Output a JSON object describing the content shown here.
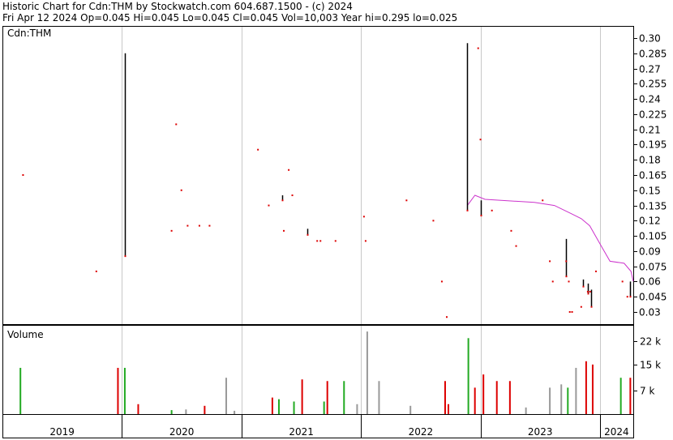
{
  "header": {
    "line1": "Historic Chart for Cdn:THM by Stockwatch.com 604.687.1500 - (c) 2024",
    "line2": "Fri Apr 12 2024   Op=0.045  Hi=0.045  Lo=0.045  Cl=0.045  Vol=10,003  Year hi=0.295  lo=0.025"
  },
  "colors": {
    "up": "#22aa22",
    "down": "#dd0000",
    "neutral": "#999999",
    "ma": "#cc33cc",
    "bar": "#000000",
    "grid": "#c8c8c8"
  },
  "chart_data": [
    {
      "type": "line",
      "title": "Cdn:THM",
      "symbol": "Cdn:THM",
      "y_ticks": [
        "0.30",
        "0.285",
        "0.27",
        "0.255",
        "0.24",
        "0.225",
        "0.21",
        "0.195",
        "0.18",
        "0.165",
        "0.15",
        "0.135",
        "0.12",
        "0.105",
        "0.09",
        "0.075",
        "0.06",
        "0.045",
        "0.03"
      ],
      "ylim": [
        0.018,
        0.312
      ],
      "x_ticks": [
        "2019",
        "2020",
        "2021",
        "2022",
        "2023",
        "2024"
      ],
      "xlim": [
        "2019-01-01",
        "2024-04-12"
      ],
      "ranges": [
        {
          "date": "2020-01-10",
          "high": 0.285,
          "low": 0.085
        },
        {
          "date": "2021-05-05",
          "high": 0.145,
          "low": 0.14
        },
        {
          "date": "2021-07-20",
          "high": 0.112,
          "low": 0.106
        },
        {
          "date": "2022-11-20",
          "high": 0.295,
          "low": 0.13
        },
        {
          "date": "2023-01-01",
          "high": 0.14,
          "low": 0.125
        },
        {
          "date": "2023-09-20",
          "high": 0.102,
          "low": 0.065
        },
        {
          "date": "2023-11-10",
          "high": 0.062,
          "low": 0.055
        },
        {
          "date": "2023-11-25",
          "high": 0.058,
          "low": 0.048
        },
        {
          "date": "2023-12-05",
          "high": 0.052,
          "low": 0.035
        },
        {
          "date": "2024-04-03",
          "high": 0.06,
          "low": 0.045
        }
      ],
      "points": [
        {
          "date": "2019-03-05",
          "price": 0.165
        },
        {
          "date": "2019-10-15",
          "price": 0.07
        },
        {
          "date": "2020-06-01",
          "price": 0.11
        },
        {
          "date": "2020-06-15",
          "price": 0.215
        },
        {
          "date": "2020-07-01",
          "price": 0.15
        },
        {
          "date": "2020-07-20",
          "price": 0.115
        },
        {
          "date": "2020-08-25",
          "price": 0.115
        },
        {
          "date": "2020-09-25",
          "price": 0.115
        },
        {
          "date": "2021-02-20",
          "price": 0.19
        },
        {
          "date": "2021-03-25",
          "price": 0.135
        },
        {
          "date": "2021-05-10",
          "price": 0.11
        },
        {
          "date": "2021-05-25",
          "price": 0.17
        },
        {
          "date": "2021-06-05",
          "price": 0.145
        },
        {
          "date": "2021-08-20",
          "price": 0.1
        },
        {
          "date": "2021-08-30",
          "price": 0.1
        },
        {
          "date": "2021-10-15",
          "price": 0.1
        },
        {
          "date": "2022-01-10",
          "price": 0.124
        },
        {
          "date": "2022-01-15",
          "price": 0.1
        },
        {
          "date": "2022-05-20",
          "price": 0.14
        },
        {
          "date": "2022-08-10",
          "price": 0.12
        },
        {
          "date": "2022-09-05",
          "price": 0.06
        },
        {
          "date": "2022-09-20",
          "price": 0.025
        },
        {
          "date": "2022-12-25",
          "price": 0.29
        },
        {
          "date": "2023-01-01",
          "price": 0.2
        },
        {
          "date": "2023-02-05",
          "price": 0.13
        },
        {
          "date": "2023-04-05",
          "price": 0.11
        },
        {
          "date": "2023-04-20",
          "price": 0.095
        },
        {
          "date": "2023-07-10",
          "price": 0.14
        },
        {
          "date": "2023-08-01",
          "price": 0.08
        },
        {
          "date": "2023-08-10",
          "price": 0.06
        },
        {
          "date": "2023-09-20",
          "price": 0.08
        },
        {
          "date": "2023-09-28",
          "price": 0.06
        },
        {
          "date": "2023-10-01",
          "price": 0.03
        },
        {
          "date": "2023-10-08",
          "price": 0.03
        },
        {
          "date": "2023-11-05",
          "price": 0.035
        },
        {
          "date": "2023-11-25",
          "price": 0.05
        },
        {
          "date": "2023-12-02",
          "price": 0.05
        },
        {
          "date": "2023-12-20",
          "price": 0.07
        },
        {
          "date": "2024-03-10",
          "price": 0.06
        },
        {
          "date": "2024-03-25",
          "price": 0.045
        }
      ],
      "moving_average": {
        "color": "#cc33cc",
        "points": [
          {
            "date": "2022-11-22",
            "value": 0.135
          },
          {
            "date": "2022-12-15",
            "value": 0.145
          },
          {
            "date": "2023-01-15",
            "value": 0.141
          },
          {
            "date": "2023-06-15",
            "value": 0.138
          },
          {
            "date": "2023-08-15",
            "value": 0.135
          },
          {
            "date": "2023-10-05",
            "value": 0.127
          },
          {
            "date": "2023-11-05",
            "value": 0.122
          },
          {
            "date": "2023-12-01",
            "value": 0.115
          },
          {
            "date": "2024-01-05",
            "value": 0.095
          },
          {
            "date": "2024-02-01",
            "value": 0.08
          },
          {
            "date": "2024-03-15",
            "value": 0.078
          },
          {
            "date": "2024-04-05",
            "value": 0.07
          },
          {
            "date": "2024-04-12",
            "value": 0.06
          }
        ]
      }
    },
    {
      "type": "bar",
      "title": "Volume",
      "y_ticks": [
        "22 k",
        "15 k",
        "7 k"
      ],
      "ylim": [
        0,
        27000
      ],
      "x_ticks": [
        "2019",
        "2020",
        "2021",
        "2022",
        "2023",
        "2024"
      ],
      "bars": [
        {
          "date": "2019-02-25",
          "volume": 14000,
          "dir": "up"
        },
        {
          "date": "2019-12-20",
          "volume": 14000,
          "dir": "down"
        },
        {
          "date": "2020-02-20",
          "volume": 3000,
          "dir": "down"
        },
        {
          "date": "2020-01-10",
          "volume": 14000,
          "dir": "up"
        },
        {
          "date": "2020-06-01",
          "volume": 1200,
          "dir": "up"
        },
        {
          "date": "2020-07-15",
          "volume": 1400,
          "dir": "neutral"
        },
        {
          "date": "2020-09-10",
          "volume": 2500,
          "dir": "down"
        },
        {
          "date": "2020-11-15",
          "volume": 11000,
          "dir": "neutral"
        },
        {
          "date": "2020-12-10",
          "volume": 1000,
          "dir": "neutral"
        },
        {
          "date": "2021-04-25",
          "volume": 4500,
          "dir": "up"
        },
        {
          "date": "2021-04-05",
          "volume": 5000,
          "dir": "down"
        },
        {
          "date": "2021-06-10",
          "volume": 3800,
          "dir": "up"
        },
        {
          "date": "2021-07-05",
          "volume": 10500,
          "dir": "down"
        },
        {
          "date": "2021-09-20",
          "volume": 10000,
          "dir": "down"
        },
        {
          "date": "2021-09-10",
          "volume": 3800,
          "dir": "up"
        },
        {
          "date": "2021-11-10",
          "volume": 10000,
          "dir": "up"
        },
        {
          "date": "2021-12-20",
          "volume": 3000,
          "dir": "neutral"
        },
        {
          "date": "2022-01-20",
          "volume": 25000,
          "dir": "neutral"
        },
        {
          "date": "2022-02-25",
          "volume": 10000,
          "dir": "neutral"
        },
        {
          "date": "2022-06-01",
          "volume": 2500,
          "dir": "neutral"
        },
        {
          "date": "2022-09-15",
          "volume": 10000,
          "dir": "down"
        },
        {
          "date": "2022-09-25",
          "volume": 3000,
          "dir": "down"
        },
        {
          "date": "2022-11-25",
          "volume": 23000,
          "dir": "up"
        },
        {
          "date": "2022-12-15",
          "volume": 8000,
          "dir": "down"
        },
        {
          "date": "2023-01-10",
          "volume": 12000,
          "dir": "down"
        },
        {
          "date": "2023-02-20",
          "volume": 10000,
          "dir": "down"
        },
        {
          "date": "2023-04-01",
          "volume": 10000,
          "dir": "down"
        },
        {
          "date": "2023-05-20",
          "volume": 2000,
          "dir": "neutral"
        },
        {
          "date": "2023-08-01",
          "volume": 8000,
          "dir": "neutral"
        },
        {
          "date": "2023-09-05",
          "volume": 9000,
          "dir": "neutral"
        },
        {
          "date": "2023-09-25",
          "volume": 8000,
          "dir": "up"
        },
        {
          "date": "2023-10-20",
          "volume": 14000,
          "dir": "neutral"
        },
        {
          "date": "2023-11-20",
          "volume": 16000,
          "dir": "down"
        },
        {
          "date": "2023-12-10",
          "volume": 15000,
          "dir": "down"
        },
        {
          "date": "2024-03-05",
          "volume": 11000,
          "dir": "up"
        },
        {
          "date": "2024-04-03",
          "volume": 11000,
          "dir": "down"
        }
      ]
    }
  ]
}
